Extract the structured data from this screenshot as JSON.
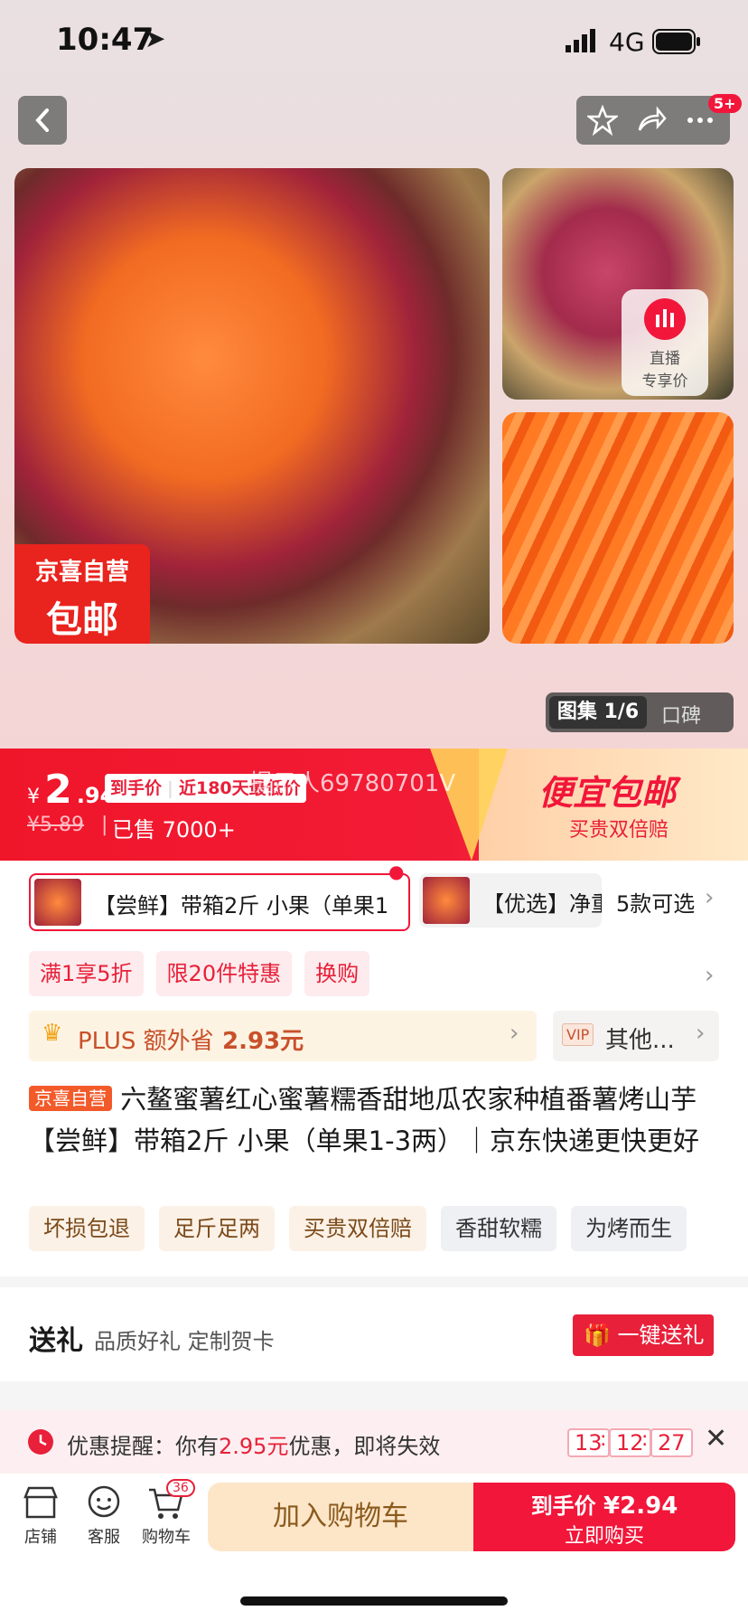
{
  "status": {
    "time": "10:47",
    "network": "4G"
  },
  "nav": {
    "notif_count": "5+"
  },
  "hero": {
    "badge_line1": "京喜自营",
    "badge_line2": "包邮",
    "live_line1": "直播",
    "live_line2": "专享价",
    "gallery_label": "图集 1/6",
    "reviews_label": "口碑"
  },
  "price": {
    "currency": "¥",
    "integer": "2",
    "decimal": ".94",
    "final_label": "到手价",
    "low_label": "近180天最低价",
    "watermark": "提示人69780701V",
    "original": "¥5.89",
    "sold": "已售 7000+",
    "promo_title": "便宜包邮",
    "promo_sub": "买贵双倍赔"
  },
  "sku": {
    "selected": "【尝鲜】带箱2斤 小果（单果1",
    "other": "【优选】净重",
    "count": "5款可选"
  },
  "promo_tags": [
    "满1享5折",
    "限20件特惠",
    "换购"
  ],
  "plus": {
    "label": "PLUS 额外省",
    "amount": "2.93元",
    "vip": "VIP",
    "other": "其他..."
  },
  "title": {
    "store_tag": "京喜自营",
    "text": "六鳌蜜薯红心蜜薯糯香甜地瓜农家种植番薯烤山芋 【尝鲜】带箱2斤 小果（单果1-3两）｜京东快递更快更好"
  },
  "features": [
    "坏损包退",
    "足斤足两",
    "买贵双倍赔",
    "香甜软糯",
    "为烤而生"
  ],
  "gift": {
    "title": "送礼",
    "desc": "品质好礼 定制贺卡",
    "button": "一键送礼"
  },
  "coupon": {
    "prefix": "优惠提醒：你有",
    "amount": "2.95元",
    "suffix": "优惠，即将失效",
    "h": "13",
    "m": "12",
    "s": "27"
  },
  "bottom": {
    "shop": "店铺",
    "service": "客服",
    "cart": "购物车",
    "cart_count": "36",
    "add_cart": "加入购物车",
    "buy_label": "到手价",
    "buy_price": "¥2.94",
    "buy_now": "立即购买"
  },
  "colors": {
    "accent": "#f2163a",
    "gold": "#ffd15a",
    "plus": "#c8502a"
  }
}
